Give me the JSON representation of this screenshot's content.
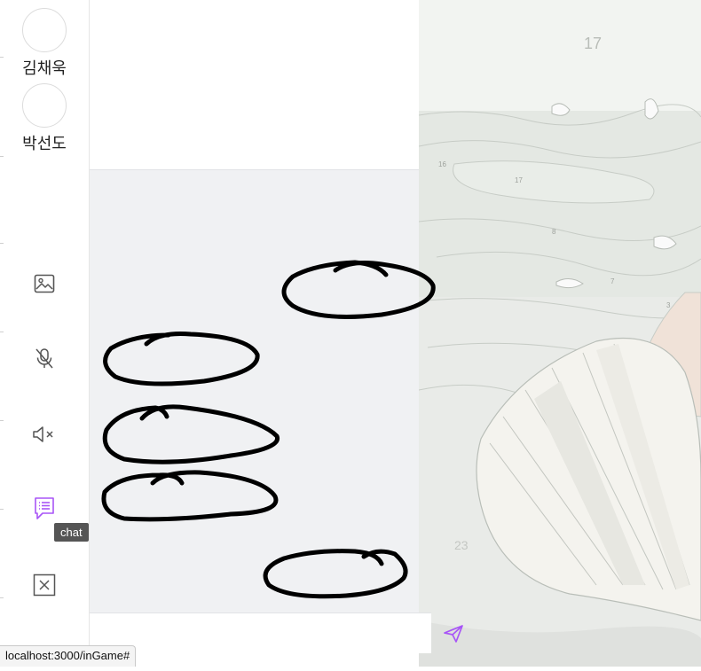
{
  "players": [
    {
      "name": "김채욱"
    },
    {
      "name": "박선도"
    }
  ],
  "toolbar": {
    "items": [
      {
        "name": "image",
        "icon": "image-icon"
      },
      {
        "name": "mic",
        "icon": "mic-off-icon"
      },
      {
        "name": "speaker",
        "icon": "speaker-muted-icon"
      },
      {
        "name": "chat",
        "icon": "chat-icon",
        "active": true
      },
      {
        "name": "exit",
        "icon": "close-box-icon"
      }
    ],
    "tooltip": "chat"
  },
  "chat": {
    "input_value": "",
    "input_placeholder": "",
    "send_icon": "send-icon",
    "accent": "#a855f7"
  },
  "canvas": {
    "region_numbers": [
      "17",
      "16",
      "17",
      "8",
      "7",
      "3",
      "23"
    ]
  },
  "status_bar": {
    "url": "localhost:3000/inGame#"
  }
}
